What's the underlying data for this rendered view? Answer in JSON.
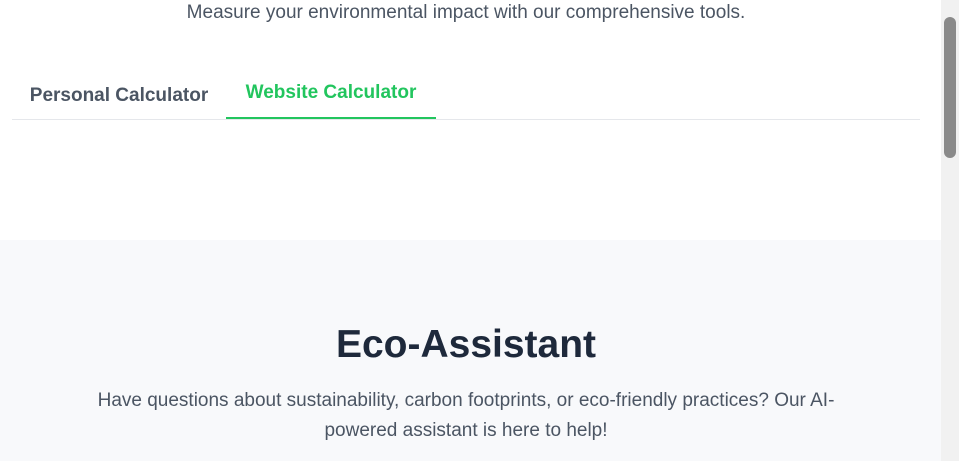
{
  "calculator": {
    "subtitle": "Measure your environmental impact with our comprehensive tools.",
    "tabs": [
      {
        "label": "Personal Calculator",
        "active": false
      },
      {
        "label": "Website Calculator",
        "active": true
      }
    ],
    "accent_color": "#22c55e"
  },
  "assistant": {
    "title": "Eco-Assistant",
    "description": "Have questions about sustainability, carbon footprints, or eco-friendly practices? Our AI-powered assistant is here to help!"
  }
}
